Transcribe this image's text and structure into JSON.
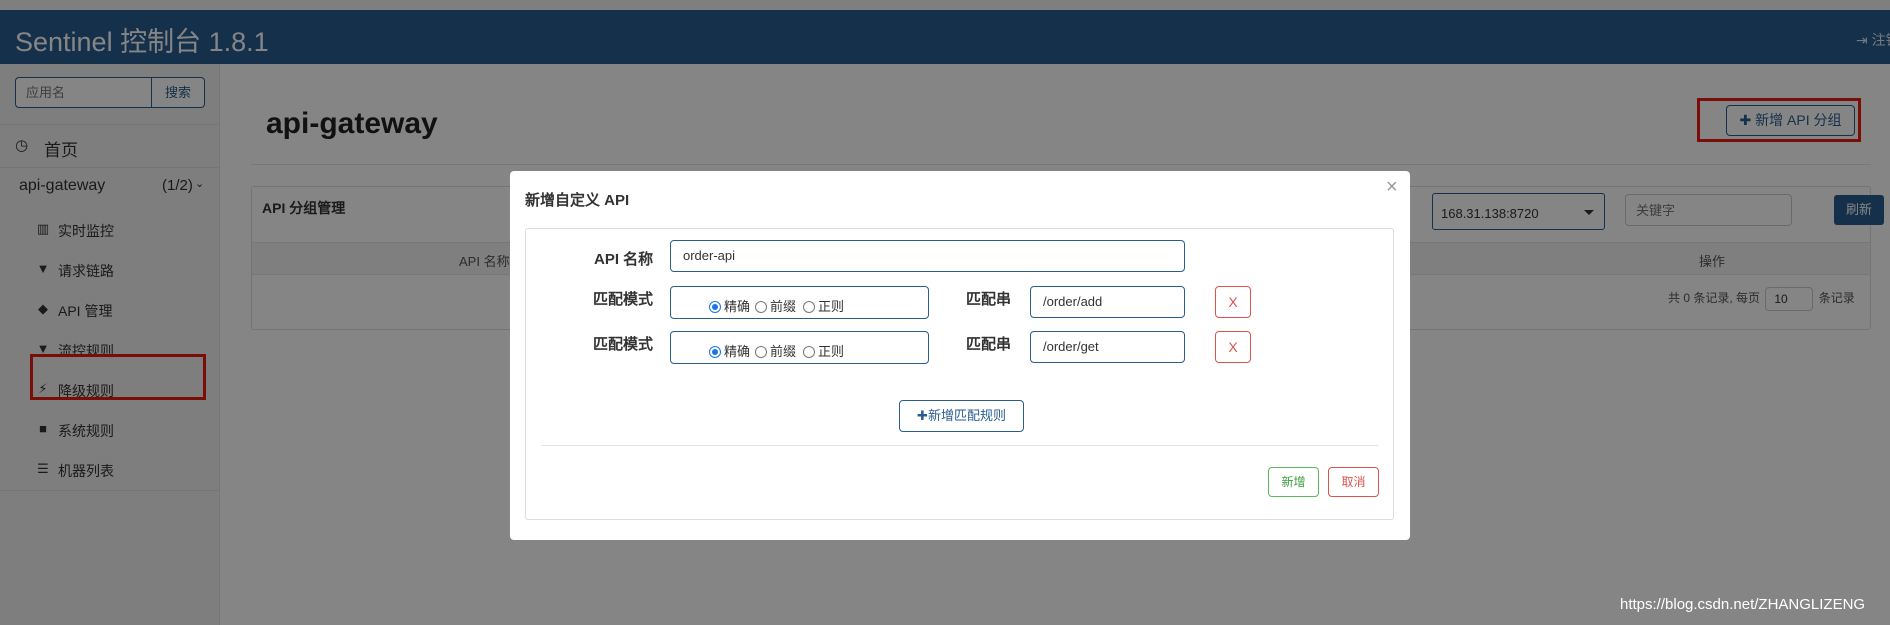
{
  "app": {
    "title": "Sentinel 控制台 1.8.1",
    "logout_label": "注销"
  },
  "sidebar": {
    "search_placeholder": "应用名",
    "search_button": "搜索",
    "home_label": "首页",
    "app_name": "api-gateway",
    "app_count": "(1/2)",
    "items": [
      {
        "label": "实时监控",
        "icon": "bar-chart-icon"
      },
      {
        "label": "请求链路",
        "icon": "filter-icon"
      },
      {
        "label": "API 管理",
        "icon": "tags-icon"
      },
      {
        "label": "流控规则",
        "icon": "filter-icon"
      },
      {
        "label": "降级规则",
        "icon": "flash-icon"
      },
      {
        "label": "系统规则",
        "icon": "lock-icon"
      },
      {
        "label": "机器列表",
        "icon": "list-icon"
      }
    ]
  },
  "main": {
    "title": "api-gateway",
    "add_api_button": "新增 API 分组",
    "panel_title": "API 分组管理",
    "ip_select_value": "168.31.138:8720",
    "keyword_placeholder": "关键字",
    "refresh_button": "刷新",
    "columns": [
      "API 名称",
      "操作"
    ],
    "pager": {
      "prefix": "共 0 条记录, 每页",
      "page_size": "10",
      "suffix": "条记录"
    }
  },
  "modal": {
    "title": "新增自定义 API",
    "api_name_label": "API 名称",
    "api_name_value": "order-api",
    "match_mode_label": "匹配模式",
    "match_string_label": "匹配串",
    "radio_options": [
      "精确",
      "前缀",
      "正则"
    ],
    "rules": [
      {
        "selected": "精确",
        "pattern": "/order/add",
        "remove_label": "X"
      },
      {
        "selected": "精确",
        "pattern": "/order/get",
        "remove_label": "X"
      }
    ],
    "add_rule_button": "新增匹配规则",
    "confirm_button": "新增",
    "cancel_button": "取消"
  },
  "watermark": "https://blog.csdn.net/ZHANGLIZENG",
  "colors": {
    "navbar": "#2a5d8f",
    "highlight": "#e8190f",
    "radio_active": "#1a73e8"
  }
}
